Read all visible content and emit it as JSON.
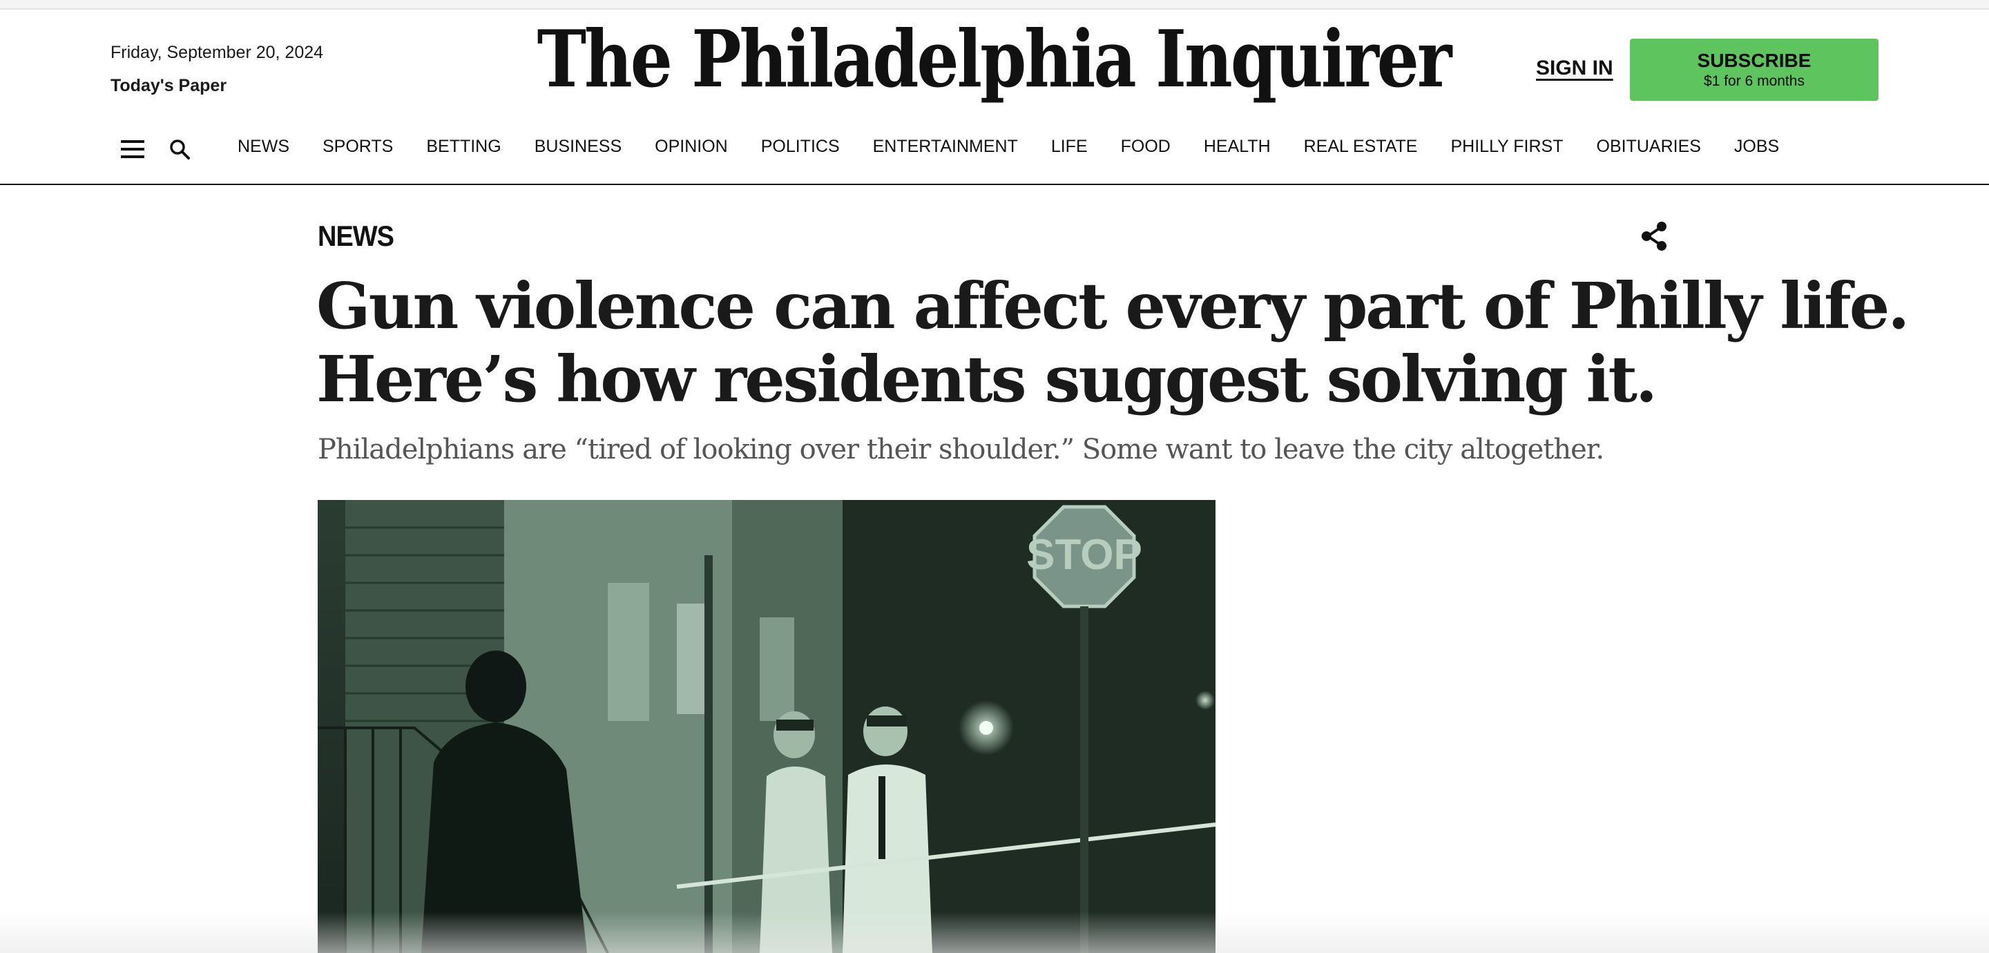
{
  "header": {
    "date": "Friday, September 20, 2024",
    "todays_paper": "Today's Paper",
    "logo": "The Philadelphia Inquirer",
    "sign_in": "SIGN IN",
    "subscribe_label": "SUBSCRIBE",
    "subscribe_offer": "$1 for 6 months",
    "subscribe_color": "#5ec45e"
  },
  "nav": {
    "menu_icon": "hamburger-menu-icon",
    "search_icon": "search-icon",
    "items": [
      "NEWS",
      "SPORTS",
      "BETTING",
      "BUSINESS",
      "OPINION",
      "POLITICS",
      "ENTERTAINMENT",
      "LIFE",
      "FOOD",
      "HEALTH",
      "REAL ESTATE",
      "PHILLY FIRST",
      "OBITUARIES",
      "JOBS"
    ]
  },
  "article": {
    "section": "NEWS",
    "share_icon": "share-icon",
    "headline_line1": "Gun violence can affect every part of Philly life.",
    "headline_line2": "Here’s how residents suggest solving it.",
    "dek": "Philadelphians are “tired of looking over their shoulder.” Some want to leave the city altogether.",
    "photo_stop_sign": "STOP"
  }
}
